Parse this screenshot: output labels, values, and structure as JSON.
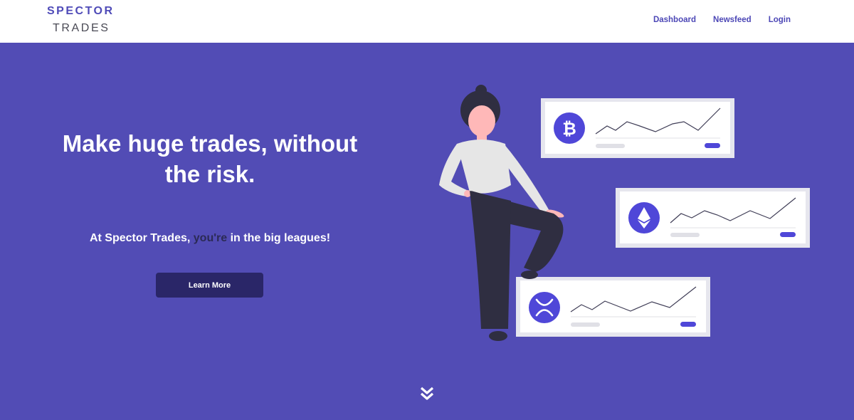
{
  "brand": {
    "name_line1": "SPECTOR",
    "name_line2": "TRADES"
  },
  "nav": {
    "links": [
      {
        "label": "Dashboard"
      },
      {
        "label": "Newsfeed"
      },
      {
        "label": "Login"
      }
    ]
  },
  "hero": {
    "headline": "Make huge trades, without the risk.",
    "subline_prefix": "At Spector Trades, ",
    "subline_accent": "you're",
    "subline_suffix": " in the big leagues!",
    "cta_label": "Learn More"
  },
  "illustration": {
    "cards": [
      {
        "coin": "bitcoin-icon"
      },
      {
        "coin": "ethereum-icon"
      },
      {
        "coin": "xrp-icon"
      }
    ]
  },
  "colors": {
    "brand": "#524cb5",
    "button": "#2a2668",
    "nav_link": "#4c47b6",
    "accent_text": "#2b2a55"
  }
}
